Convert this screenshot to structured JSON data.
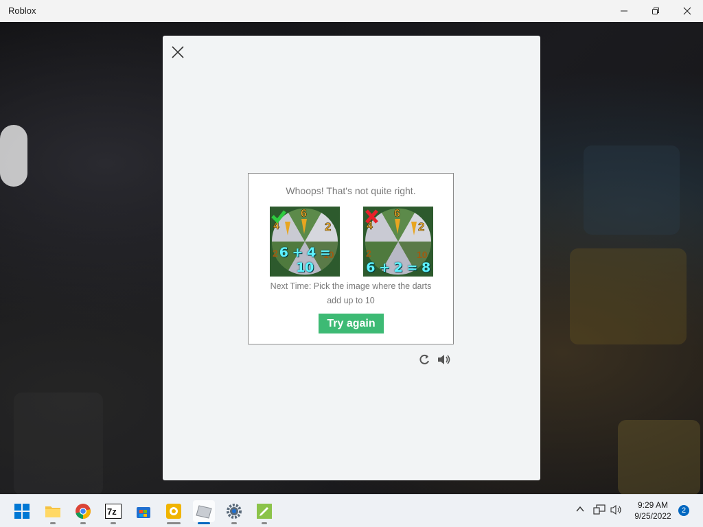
{
  "window": {
    "title": "Roblox",
    "minimize_icon": "minimize-icon",
    "maximize_icon": "restore-icon",
    "close_icon": "close-icon"
  },
  "modal": {
    "close_icon": "close-x-icon",
    "challenge": {
      "message": "Whoops! That's not quite right.",
      "options": [
        {
          "equation": "6 + 4 = 10",
          "mark": "check-icon",
          "mark_color": "#2ecc40"
        },
        {
          "equation": "6 + 2 = 8",
          "mark": "cross-icon",
          "mark_color": "#e8202a"
        }
      ],
      "hint": "Next Time: Pick the image where the darts add up to 10",
      "try_again_label": "Try again",
      "button_color": "#3dba74"
    },
    "tools": [
      "refresh-icon",
      "audio-icon"
    ]
  },
  "taskbar": {
    "apps": [
      "windows-start-icon",
      "file-explorer-icon",
      "chrome-icon",
      "7zip-icon",
      "microsoft-store-icon",
      "plex-icon",
      "roblox-icon",
      "settings-icon",
      "notepad-icon"
    ],
    "tray": [
      "chevron-up-icon",
      "network-icon",
      "volume-icon"
    ],
    "time": "9:29 AM",
    "date": "9/25/2022",
    "notification_count": "2",
    "accent": "#0067c0"
  }
}
